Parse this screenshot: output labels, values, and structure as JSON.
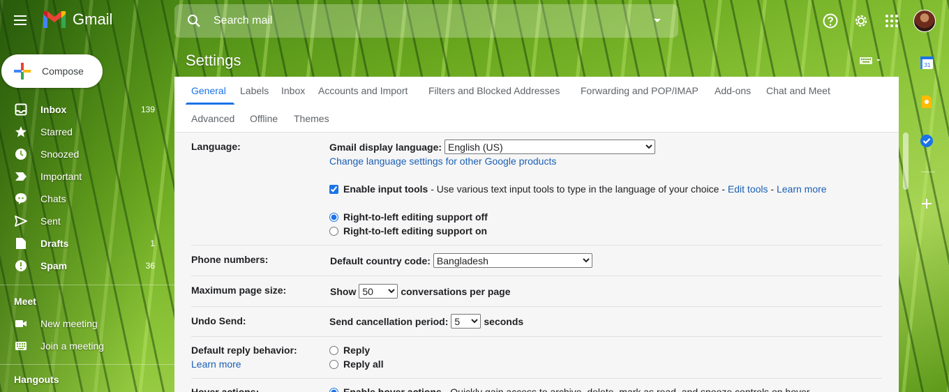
{
  "app": {
    "name": "Gmail"
  },
  "search": {
    "placeholder": "Search mail"
  },
  "compose": {
    "label": "Compose"
  },
  "nav": {
    "items": [
      {
        "label": "Inbox",
        "count": "139",
        "icon": "inbox-icon"
      },
      {
        "label": "Starred",
        "count": "",
        "icon": "star-icon"
      },
      {
        "label": "Snoozed",
        "count": "",
        "icon": "clock-icon"
      },
      {
        "label": "Important",
        "count": "",
        "icon": "important-icon"
      },
      {
        "label": "Chats",
        "count": "",
        "icon": "chat-icon"
      },
      {
        "label": "Sent",
        "count": "",
        "icon": "send-icon"
      },
      {
        "label": "Drafts",
        "count": "1",
        "icon": "draft-icon"
      },
      {
        "label": "Spam",
        "count": "36",
        "icon": "spam-icon"
      }
    ]
  },
  "meet": {
    "title": "Meet",
    "new_meeting": "New meeting",
    "join_meeting": "Join a meeting"
  },
  "hangouts": {
    "title": "Hangouts"
  },
  "settings": {
    "title": "Settings",
    "tabs": [
      "General",
      "Labels",
      "Inbox",
      "Accounts and Import",
      "Filters and Blocked Addresses",
      "Forwarding and POP/IMAP",
      "Add-ons",
      "Chat and Meet",
      "Advanced",
      "Offline",
      "Themes"
    ],
    "active_tab": "General",
    "language": {
      "label": "Language:",
      "display_label": "Gmail display language:",
      "display_value": "English (US)",
      "change_link": "Change language settings for other Google products",
      "input_tools_label": "Enable input tools",
      "input_tools_desc": " - Use various text input tools to type in the language of your choice - ",
      "edit_tools": "Edit tools",
      "dash": " - ",
      "learn_more": "Learn more",
      "rtl_off": "Right-to-left editing support off",
      "rtl_on": "Right-to-left editing support on"
    },
    "phone": {
      "label": "Phone numbers:",
      "country_label": "Default country code:",
      "country_value": "Bangladesh"
    },
    "page_size": {
      "label": "Maximum page size:",
      "show": "Show",
      "value": "50",
      "suffix": "conversations per page"
    },
    "undo_send": {
      "label": "Undo Send:",
      "period_label": "Send cancellation period:",
      "value": "5",
      "suffix": "seconds"
    },
    "reply": {
      "label": "Default reply behavior:",
      "learn_more": "Learn more",
      "reply": "Reply",
      "reply_all": "Reply all"
    },
    "hover": {
      "label": "Hover actions:",
      "enable": "Enable hover actions",
      "desc": " - Quickly gain access to archive, delete, mark as read, and snooze controls on hover."
    }
  },
  "colors": {
    "accent": "#1a73e8",
    "link": "#1a5fb4"
  }
}
